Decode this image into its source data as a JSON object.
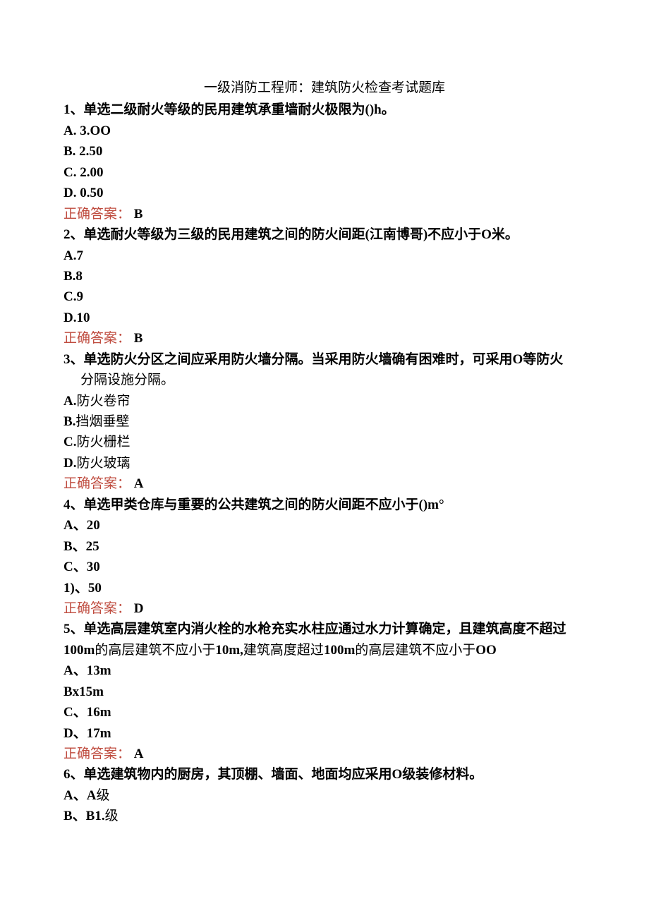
{
  "title": "一级消防工程师：建筑防火检查考试题库",
  "answerLabel": "正确答案：",
  "questions": [
    {
      "stem": "1、单选二级耐火等级的民用建筑承重墙耐火极限为()h。",
      "options": [
        "A.   3.OO",
        "B.   2.50",
        "C.   2.00",
        "D.   0.50"
      ],
      "optionsBold": true,
      "answer": "B"
    },
    {
      "stem": "2、单选耐火等级为三级的民用建筑之间的防火间距(江南博哥)不应小于O米。",
      "options": [
        "A.7",
        "B.8",
        "C.9",
        "D.10"
      ],
      "optionsBold": true,
      "answer": "B"
    },
    {
      "stem": "3、单选防火分区之间应采用防火墙分隔。当采用防火墙确有困难时，可采用O等防火",
      "stemLine2": "分隔设施分隔。",
      "options": [
        "A.防火卷帘",
        "B.挡烟垂壁",
        "C.防火栅栏",
        "D.防火玻璃"
      ],
      "optionsBold": false,
      "optionPrefixBold": true,
      "answer": "A"
    },
    {
      "stem": "4、单选甲类仓库与重要的公共建筑之间的防火间距不应小于()m°",
      "options": [
        "A、20",
        "B、25",
        "C、30",
        "1)、50"
      ],
      "optionsBold": true,
      "answer": "D"
    },
    {
      "stem": "5、单选高层建筑室内消火栓的水枪充实水柱应通过水力计算确定，且建筑高度不超过",
      "stemLine2a": "100m",
      "stemLine2b": "的高层建筑不应小于",
      "stemLine2c": "10m,",
      "stemLine2d": "建筑高度超过",
      "stemLine2e": "100m",
      "stemLine2f": "的高层建筑不应小于",
      "stemLine2g": "OO",
      "options": [
        "A、13m",
        "Bx15m",
        "C、16m",
        "D、17m"
      ],
      "optionsBold": true,
      "answer": "A"
    },
    {
      "stem": "6、单选建筑物内的厨房，其顶棚、墙面、地面均应采用O级装修材料。",
      "options": [
        "A、A级",
        "B、B1.级"
      ],
      "optionPrefixBold": true,
      "fullBoldFirst": true,
      "answer": null
    }
  ]
}
